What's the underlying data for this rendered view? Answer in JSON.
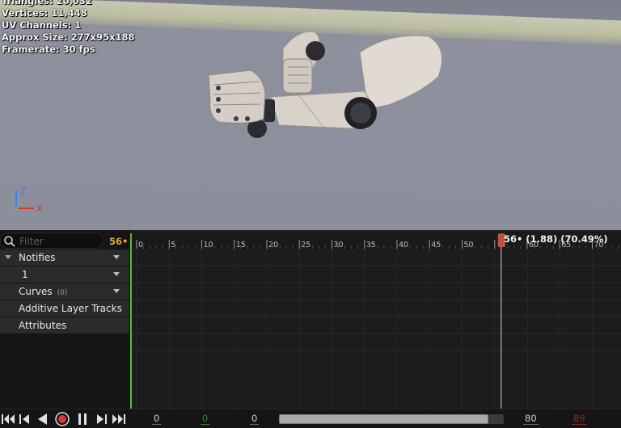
{
  "viewport": {
    "stats": [
      "Triangles: 20,032",
      "Vertices: 11,448",
      "UV Channels: 1",
      "Approx Size: 277x95x188",
      "Framerate: 30 fps"
    ],
    "axis_labels": {
      "z": "Z",
      "x": "X"
    },
    "colors": {
      "z_axis": "#3e7ff0",
      "x_axis": "#e0312f",
      "y_axis": "#66cc33"
    }
  },
  "tracks_panel": {
    "filter_placeholder": "Filter",
    "current_frame_indicator": "56•",
    "tracks": [
      {
        "label": "Notifies",
        "expanded": true,
        "has_dropdown": true
      },
      {
        "label": "1",
        "has_dropdown": true
      },
      {
        "label": "Curves",
        "count": "(0)",
        "has_dropdown": true
      },
      {
        "label": "Additive Layer Tracks"
      },
      {
        "label": "Attributes"
      }
    ]
  },
  "timeline": {
    "ruler_labels": [
      "0",
      "5",
      "10",
      "15",
      "20",
      "25",
      "30",
      "35",
      "40",
      "45",
      "50",
      "60",
      "65",
      "70"
    ],
    "scrub_label": "56• (1.88) (70.49%)",
    "current_frame": 56,
    "colors": {
      "scrub_handle": "#c0533a",
      "start_marker": "#5fb83a",
      "playhead": "#d9d9d9"
    }
  },
  "transport": {
    "buttons": [
      "jump-to-start",
      "step-back",
      "play-reverse",
      "record",
      "pause",
      "step-forward",
      "jump-to-end"
    ],
    "view_start": "0",
    "play_start": "0",
    "view_start_2": "0",
    "view_end": "80",
    "play_end": "89",
    "scroll_position_fraction": 0.93,
    "colors": {
      "record": "#d23a3a",
      "play_start": "#2f8a2f",
      "play_end": "#8a2a2a"
    }
  }
}
